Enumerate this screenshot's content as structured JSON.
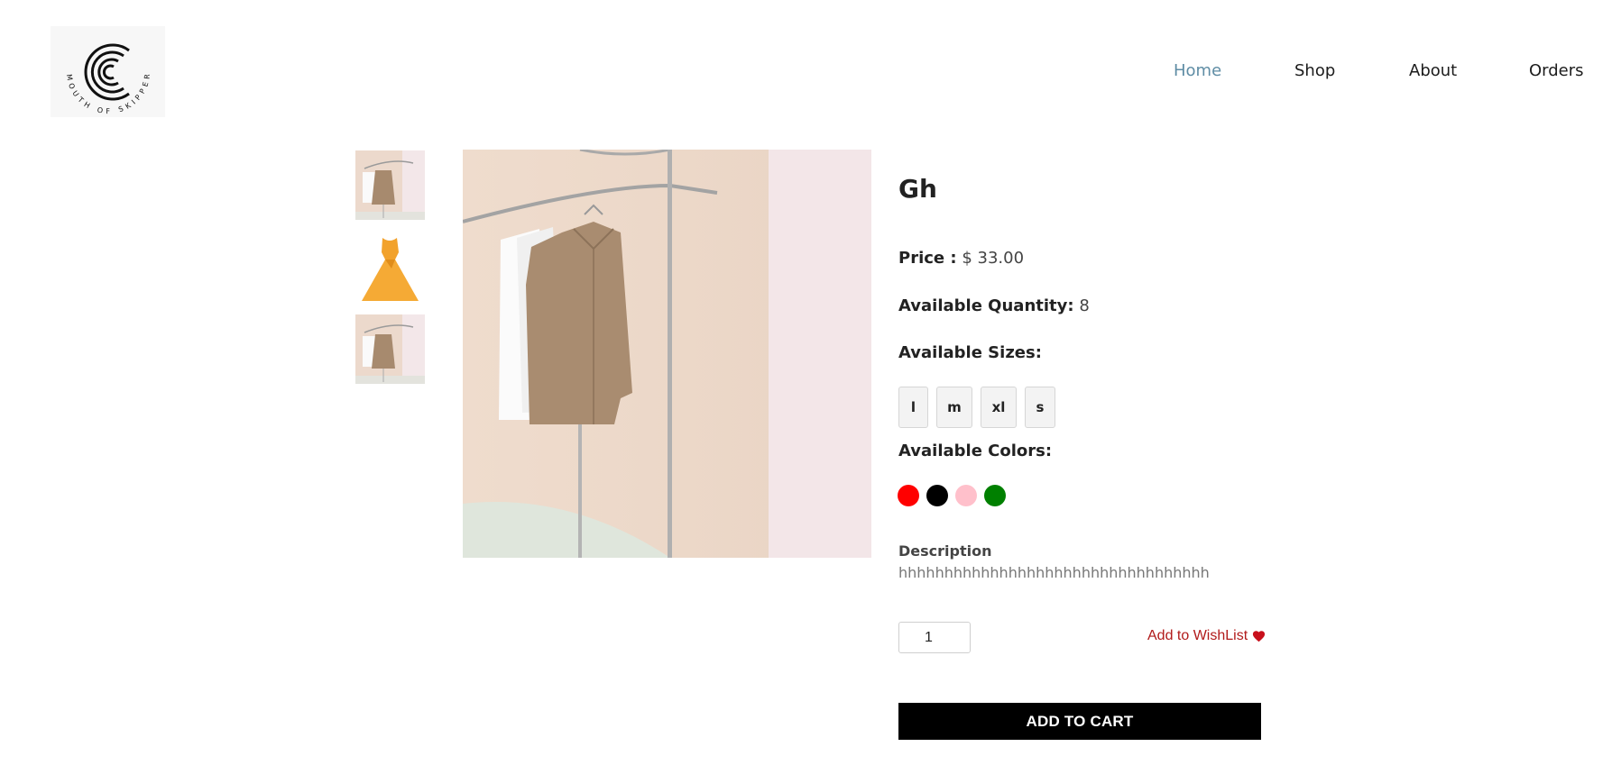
{
  "brand": {
    "logo_text": "MOUTH OF SKIPPER"
  },
  "nav": {
    "items": [
      {
        "label": "Home",
        "active": true
      },
      {
        "label": "Shop",
        "active": false
      },
      {
        "label": "About",
        "active": false
      },
      {
        "label": "Orders",
        "active": false
      }
    ]
  },
  "product": {
    "title": "Gh",
    "price_label": "Price :",
    "price_value": "$ 33.00",
    "quantity_label": "Available Quantity:",
    "quantity_value": "8",
    "sizes_label": "Available Sizes:",
    "sizes": [
      "l",
      "m",
      "xl",
      "s"
    ],
    "colors_label": "Available Colors:",
    "colors": [
      "#ff0000",
      "#000000",
      "#ffc0cb",
      "#008000"
    ],
    "description_label": "Description",
    "description": "hhhhhhhhhhhhhhhhhhhhhhhhhhhhhhhhhh",
    "images": [
      "coat-on-rack",
      "yellow-dress",
      "coat-on-rack"
    ]
  },
  "cart": {
    "quantity_value": "1",
    "wishlist_label": "Add to WishList",
    "add_to_cart_label": "ADD TO CART"
  },
  "theme": {
    "nav_active_color": "#5f8da5",
    "wishlist_color": "#b11a1a",
    "button_bg": "#000000"
  }
}
